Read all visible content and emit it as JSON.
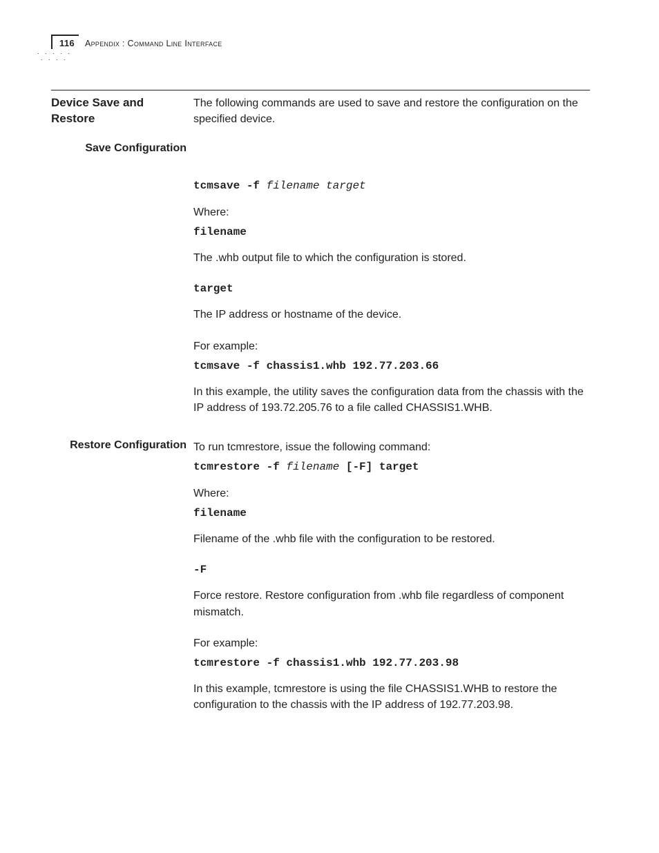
{
  "header": {
    "page_number": "116",
    "running_head": "Appendix : Command Line Interface"
  },
  "section": {
    "title": "Device Save and Restore",
    "intro": "The following commands are used to save and restore the configuration on the specified device."
  },
  "save": {
    "heading": "Save Configuration",
    "cmd_prefix": "tcmsave -f ",
    "cmd_args": "filename target",
    "where_label": "Where:",
    "filename_label": "filename",
    "filename_desc": "The .whb output file to which the configuration is stored.",
    "target_label": "target",
    "target_desc": "The IP address or hostname of the device.",
    "for_example": "For example:",
    "example_cmd": "tcmsave -f chassis1.whb 192.77.203.66",
    "example_desc": "In this example, the utility saves the configuration data from the chassis with the IP address of 193.72.205.76 to a file called CHASSIS1.WHB."
  },
  "restore": {
    "heading": "Restore Configuration",
    "intro": "To run tcmrestore, issue the following command:",
    "cmd_prefix": "tcmrestore -f ",
    "cmd_args": "filename",
    "cmd_suffix": " [-F] target",
    "where_label": "Where:",
    "filename_label": "filename",
    "filename_desc": "Filename of the .whb file with the configuration to be restored.",
    "flag_label": "-F",
    "flag_desc": "Force restore. Restore configuration from .whb file regardless of component mismatch.",
    "for_example": "For example:",
    "example_cmd": "tcmrestore -f chassis1.whb 192.77.203.98",
    "example_desc": "In this example, tcmrestore is using the file CHASSIS1.WHB to restore the configuration to the chassis with the IP address of 192.77.203.98."
  }
}
